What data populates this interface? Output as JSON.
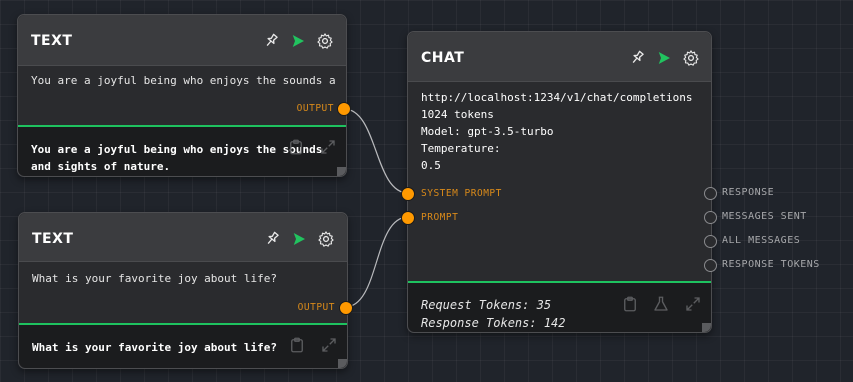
{
  "text_nodes": [
    {
      "title": "TEXT",
      "input_text": "You are a joyful being who enjoys the sounds a",
      "output_label": "OUTPUT",
      "result_lines": [
        "You are a joyful being who enjoys the sounds",
        "and sights of nature."
      ]
    },
    {
      "title": "TEXT",
      "input_text": "What is your favorite joy about life?",
      "output_label": "OUTPUT",
      "result_lines": [
        "What is your favorite joy about life?"
      ]
    }
  ],
  "chat_node": {
    "title": "CHAT",
    "config_lines": [
      "http://localhost:1234/v1/chat/completions",
      "1024 tokens",
      "Model: gpt-3.5-turbo",
      "Temperature:",
      "0.5"
    ],
    "inputs": [
      "SYSTEM PROMPT",
      "PROMPT"
    ],
    "outputs": [
      "RESPONSE",
      "MESSAGES SENT",
      "ALL MESSAGES",
      "RESPONSE TOKENS"
    ],
    "stats": [
      "Request Tokens: 35",
      "Response Tokens: 142"
    ]
  },
  "colors": {
    "accent_green": "#1ec25f",
    "port_orange": "#ff9900",
    "label_orange": "#d98a1a",
    "run_arrow_green": "#21c35f"
  },
  "icons": [
    "pin-icon",
    "play-icon",
    "gear-icon",
    "clipboard-icon",
    "flask-icon",
    "expand-icon"
  ]
}
